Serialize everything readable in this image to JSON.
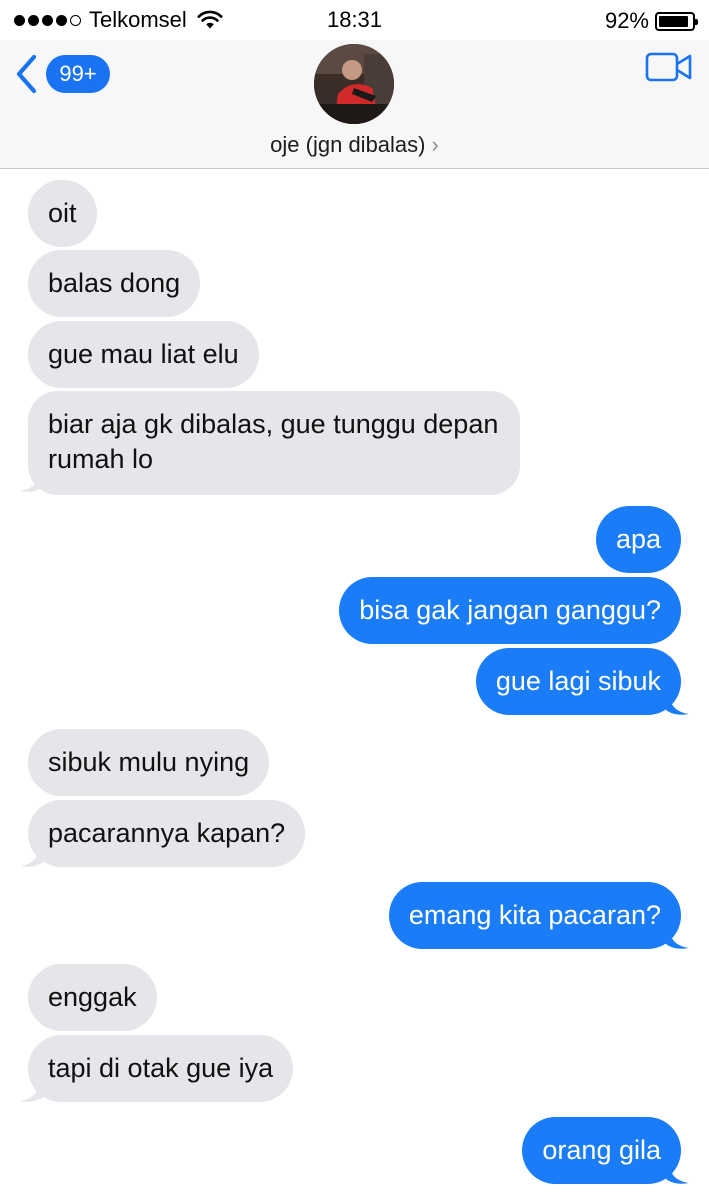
{
  "status_bar": {
    "carrier": "Telkomsel",
    "time": "18:31",
    "battery": "92%",
    "battery_level": 0.92
  },
  "header": {
    "back_badge": "99+",
    "contact_name": "oje (jgn dibalas)",
    "contact_chevron": "›"
  },
  "colors": {
    "incoming_bubble": "#e5e5ea",
    "outgoing_bubble": "#1a7cf6",
    "accent": "#1a73f3"
  },
  "icons": {
    "back": "chevron-left-icon",
    "video": "video-camera-icon",
    "wifi": "wifi-icon",
    "battery": "battery-icon"
  },
  "messages": [
    {
      "from": "them",
      "text": "oit"
    },
    {
      "from": "them",
      "text": "balas dong"
    },
    {
      "from": "them",
      "text": "gue mau liat elu"
    },
    {
      "from": "them",
      "text": "biar aja gk dibalas, gue tunggu depan"
    },
    {
      "from": "them",
      "text": "rumah lo"
    },
    {
      "from": "me",
      "text": "apa"
    },
    {
      "from": "me",
      "text": "bisa gak jangan ganggu?"
    },
    {
      "from": "me",
      "text": "gue lagi sibuk"
    },
    {
      "from": "them",
      "text": "sibuk mulu nying"
    },
    {
      "from": "them",
      "text": "pacarannya kapan?"
    },
    {
      "from": "me",
      "text": "emang kita pacaran?"
    },
    {
      "from": "them",
      "text": "enggak"
    },
    {
      "from": "them",
      "text": "tapi di otak gue iya"
    },
    {
      "from": "me",
      "text": "orang gila"
    }
  ]
}
